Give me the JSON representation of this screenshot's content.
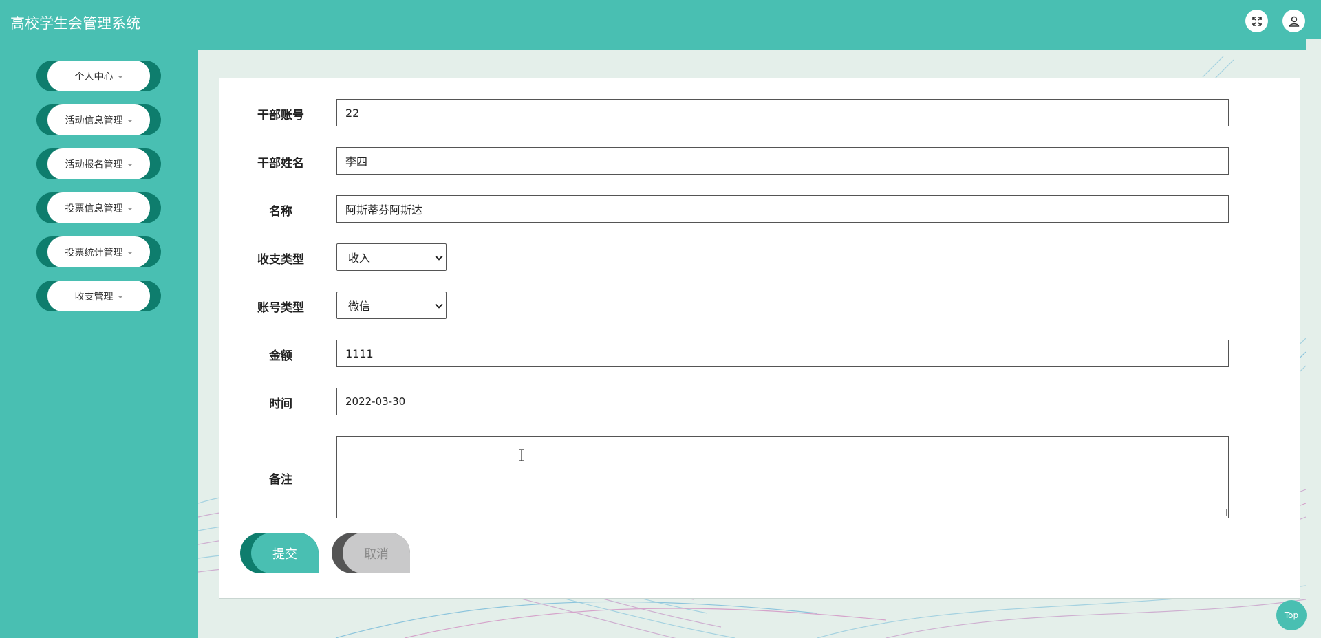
{
  "app": {
    "title": "高校学生会管理系统"
  },
  "header": {
    "fullscreen_icon": "expand-icon",
    "user_icon": "user-icon"
  },
  "sidebar": {
    "items": [
      {
        "label": "个人中心"
      },
      {
        "label": "活动信息管理"
      },
      {
        "label": "活动报名管理"
      },
      {
        "label": "投票信息管理"
      },
      {
        "label": "投票统计管理"
      },
      {
        "label": "收支管理"
      }
    ]
  },
  "form": {
    "cadre_account": {
      "label": "干部账号",
      "value": "22"
    },
    "cadre_name": {
      "label": "干部姓名",
      "value": "李四"
    },
    "name": {
      "label": "名称",
      "value": "阿斯蒂芬阿斯达"
    },
    "income_type": {
      "label": "收支类型",
      "value": "收入"
    },
    "account_type": {
      "label": "账号类型",
      "value": "微信"
    },
    "amount": {
      "label": "金额",
      "value": "1111"
    },
    "time": {
      "label": "时间",
      "value": "2022-03-30"
    },
    "remark": {
      "label": "备注",
      "value": ""
    }
  },
  "actions": {
    "submit_label": "提交",
    "cancel_label": "取消"
  },
  "back_to_top": {
    "label": "Top"
  },
  "colors": {
    "primary": "#49bfb2",
    "primary_dark": "#0e7d6d",
    "background": "#e4efea",
    "cancel": "#c9c9ca"
  }
}
